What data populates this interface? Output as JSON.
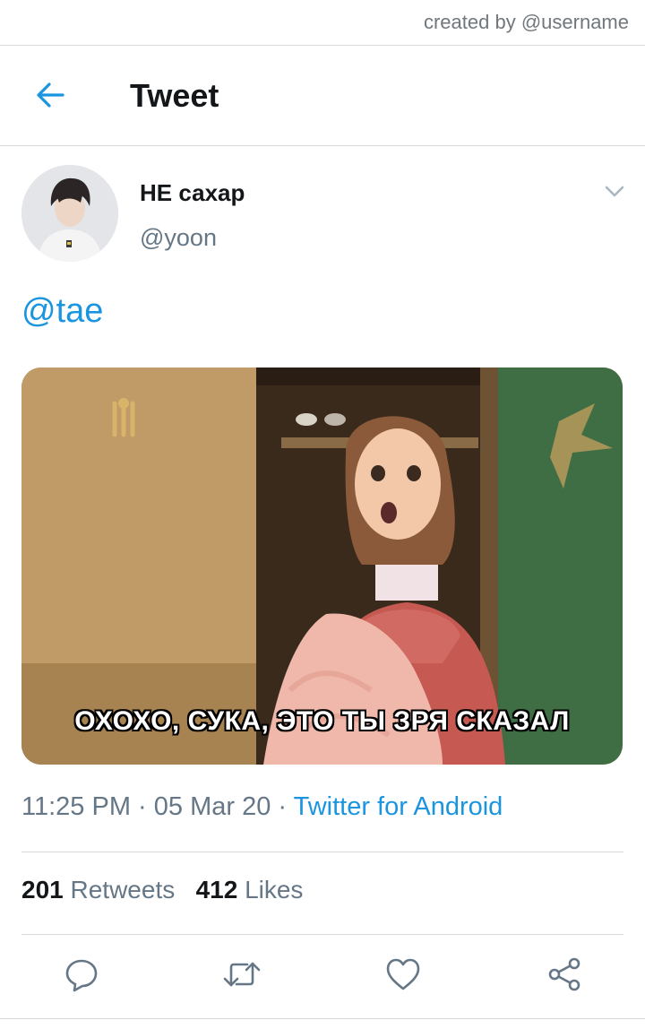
{
  "watermark": "created by @username",
  "header": {
    "title": "Tweet",
    "back_icon": "arrow-left-icon"
  },
  "tweet": {
    "author": {
      "display_name": "НЕ сахар",
      "handle": "@yoon"
    },
    "text": "@tae",
    "media": {
      "caption": "ОХОХО, СУКА, ЭТО ТЫ ЗРЯ СКАЗАЛ"
    },
    "time": "11:25 PM",
    "separator": " · ",
    "date": "05 Mar 20",
    "source": "Twitter for Android",
    "stats": {
      "retweets_count": "201",
      "retweets_label": "Retweets",
      "likes_count": "412",
      "likes_label": "Likes"
    },
    "actions": [
      "reply-icon",
      "retweet-icon",
      "like-icon",
      "share-icon"
    ]
  },
  "colors": {
    "accent": "#1b95e0",
    "muted": "#657786",
    "text": "#14171a",
    "divider": "#d6d9dc"
  }
}
